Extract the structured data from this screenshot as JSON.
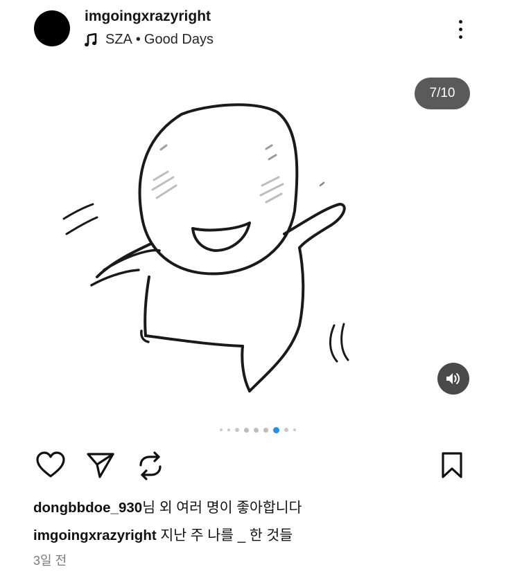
{
  "post": {
    "username": "imgoingxrazyright",
    "music": {
      "artist": "SZA",
      "separator": "•",
      "track": "Good Days"
    },
    "media": {
      "counter": "7/10",
      "carousel_total": 10,
      "carousel_current": 7
    },
    "likes": {
      "user": "dongbbdoe_930",
      "suffix": "님 외 여러 명이 좋아합니다"
    },
    "caption": {
      "user": "imgoingxrazyright",
      "text": "지난 주 나를 _ 한 것들"
    },
    "timestamp": "3일 전"
  },
  "icons": {
    "avatar": "avatar",
    "music": "music-note-icon",
    "more": "more-vertical-icon",
    "volume": "volume-icon",
    "like": "heart-icon",
    "share": "send-icon",
    "repost": "repost-icon",
    "save": "bookmark-icon"
  },
  "colors": {
    "active_dot": "#1e90f5",
    "counter_bg": "#5a5a5a",
    "volume_bg": "#4a4a4a",
    "timestamp": "#7a7a7a"
  }
}
